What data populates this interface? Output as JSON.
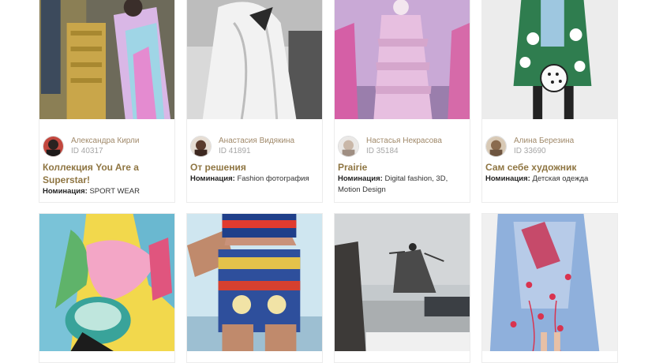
{
  "cards": [
    {
      "author": "Александра Кирли",
      "id": "ID 40317",
      "title": "Коллекция You Are a Superstar!",
      "nomination_label": "Номинация:",
      "nomination": "SPORT WEAR"
    },
    {
      "author": "Анастасия Видякина",
      "id": "ID 41891",
      "title": "От решения",
      "nomination_label": "Номинация:",
      "nomination": "Fashion фотография"
    },
    {
      "author": "Настасья Некрасова",
      "id": "ID 35184",
      "title": "Prairie",
      "nomination_label": "Номинация:",
      "nomination": "Digital fashion, 3D, Motion Design"
    },
    {
      "author": "Алина Березина",
      "id": "ID 33690",
      "title": "Сам себе художник",
      "nomination_label": "Номинация:",
      "nomination": "Детская одежда"
    }
  ],
  "colors": {
    "author": "#a0896a",
    "title": "#8f7643",
    "id": "#a6a6a6"
  }
}
